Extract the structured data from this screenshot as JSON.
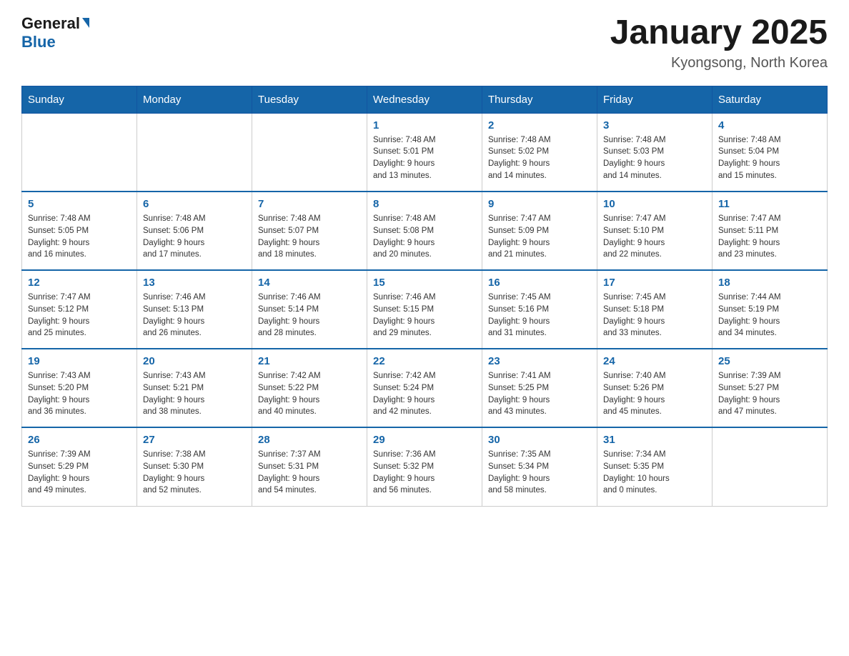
{
  "logo": {
    "general": "General",
    "blue": "Blue"
  },
  "title": "January 2025",
  "location": "Kyongsong, North Korea",
  "days_of_week": [
    "Sunday",
    "Monday",
    "Tuesday",
    "Wednesday",
    "Thursday",
    "Friday",
    "Saturday"
  ],
  "weeks": [
    [
      {
        "day": "",
        "info": ""
      },
      {
        "day": "",
        "info": ""
      },
      {
        "day": "",
        "info": ""
      },
      {
        "day": "1",
        "info": "Sunrise: 7:48 AM\nSunset: 5:01 PM\nDaylight: 9 hours\nand 13 minutes."
      },
      {
        "day": "2",
        "info": "Sunrise: 7:48 AM\nSunset: 5:02 PM\nDaylight: 9 hours\nand 14 minutes."
      },
      {
        "day": "3",
        "info": "Sunrise: 7:48 AM\nSunset: 5:03 PM\nDaylight: 9 hours\nand 14 minutes."
      },
      {
        "day": "4",
        "info": "Sunrise: 7:48 AM\nSunset: 5:04 PM\nDaylight: 9 hours\nand 15 minutes."
      }
    ],
    [
      {
        "day": "5",
        "info": "Sunrise: 7:48 AM\nSunset: 5:05 PM\nDaylight: 9 hours\nand 16 minutes."
      },
      {
        "day": "6",
        "info": "Sunrise: 7:48 AM\nSunset: 5:06 PM\nDaylight: 9 hours\nand 17 minutes."
      },
      {
        "day": "7",
        "info": "Sunrise: 7:48 AM\nSunset: 5:07 PM\nDaylight: 9 hours\nand 18 minutes."
      },
      {
        "day": "8",
        "info": "Sunrise: 7:48 AM\nSunset: 5:08 PM\nDaylight: 9 hours\nand 20 minutes."
      },
      {
        "day": "9",
        "info": "Sunrise: 7:47 AM\nSunset: 5:09 PM\nDaylight: 9 hours\nand 21 minutes."
      },
      {
        "day": "10",
        "info": "Sunrise: 7:47 AM\nSunset: 5:10 PM\nDaylight: 9 hours\nand 22 minutes."
      },
      {
        "day": "11",
        "info": "Sunrise: 7:47 AM\nSunset: 5:11 PM\nDaylight: 9 hours\nand 23 minutes."
      }
    ],
    [
      {
        "day": "12",
        "info": "Sunrise: 7:47 AM\nSunset: 5:12 PM\nDaylight: 9 hours\nand 25 minutes."
      },
      {
        "day": "13",
        "info": "Sunrise: 7:46 AM\nSunset: 5:13 PM\nDaylight: 9 hours\nand 26 minutes."
      },
      {
        "day": "14",
        "info": "Sunrise: 7:46 AM\nSunset: 5:14 PM\nDaylight: 9 hours\nand 28 minutes."
      },
      {
        "day": "15",
        "info": "Sunrise: 7:46 AM\nSunset: 5:15 PM\nDaylight: 9 hours\nand 29 minutes."
      },
      {
        "day": "16",
        "info": "Sunrise: 7:45 AM\nSunset: 5:16 PM\nDaylight: 9 hours\nand 31 minutes."
      },
      {
        "day": "17",
        "info": "Sunrise: 7:45 AM\nSunset: 5:18 PM\nDaylight: 9 hours\nand 33 minutes."
      },
      {
        "day": "18",
        "info": "Sunrise: 7:44 AM\nSunset: 5:19 PM\nDaylight: 9 hours\nand 34 minutes."
      }
    ],
    [
      {
        "day": "19",
        "info": "Sunrise: 7:43 AM\nSunset: 5:20 PM\nDaylight: 9 hours\nand 36 minutes."
      },
      {
        "day": "20",
        "info": "Sunrise: 7:43 AM\nSunset: 5:21 PM\nDaylight: 9 hours\nand 38 minutes."
      },
      {
        "day": "21",
        "info": "Sunrise: 7:42 AM\nSunset: 5:22 PM\nDaylight: 9 hours\nand 40 minutes."
      },
      {
        "day": "22",
        "info": "Sunrise: 7:42 AM\nSunset: 5:24 PM\nDaylight: 9 hours\nand 42 minutes."
      },
      {
        "day": "23",
        "info": "Sunrise: 7:41 AM\nSunset: 5:25 PM\nDaylight: 9 hours\nand 43 minutes."
      },
      {
        "day": "24",
        "info": "Sunrise: 7:40 AM\nSunset: 5:26 PM\nDaylight: 9 hours\nand 45 minutes."
      },
      {
        "day": "25",
        "info": "Sunrise: 7:39 AM\nSunset: 5:27 PM\nDaylight: 9 hours\nand 47 minutes."
      }
    ],
    [
      {
        "day": "26",
        "info": "Sunrise: 7:39 AM\nSunset: 5:29 PM\nDaylight: 9 hours\nand 49 minutes."
      },
      {
        "day": "27",
        "info": "Sunrise: 7:38 AM\nSunset: 5:30 PM\nDaylight: 9 hours\nand 52 minutes."
      },
      {
        "day": "28",
        "info": "Sunrise: 7:37 AM\nSunset: 5:31 PM\nDaylight: 9 hours\nand 54 minutes."
      },
      {
        "day": "29",
        "info": "Sunrise: 7:36 AM\nSunset: 5:32 PM\nDaylight: 9 hours\nand 56 minutes."
      },
      {
        "day": "30",
        "info": "Sunrise: 7:35 AM\nSunset: 5:34 PM\nDaylight: 9 hours\nand 58 minutes."
      },
      {
        "day": "31",
        "info": "Sunrise: 7:34 AM\nSunset: 5:35 PM\nDaylight: 10 hours\nand 0 minutes."
      },
      {
        "day": "",
        "info": ""
      }
    ]
  ]
}
